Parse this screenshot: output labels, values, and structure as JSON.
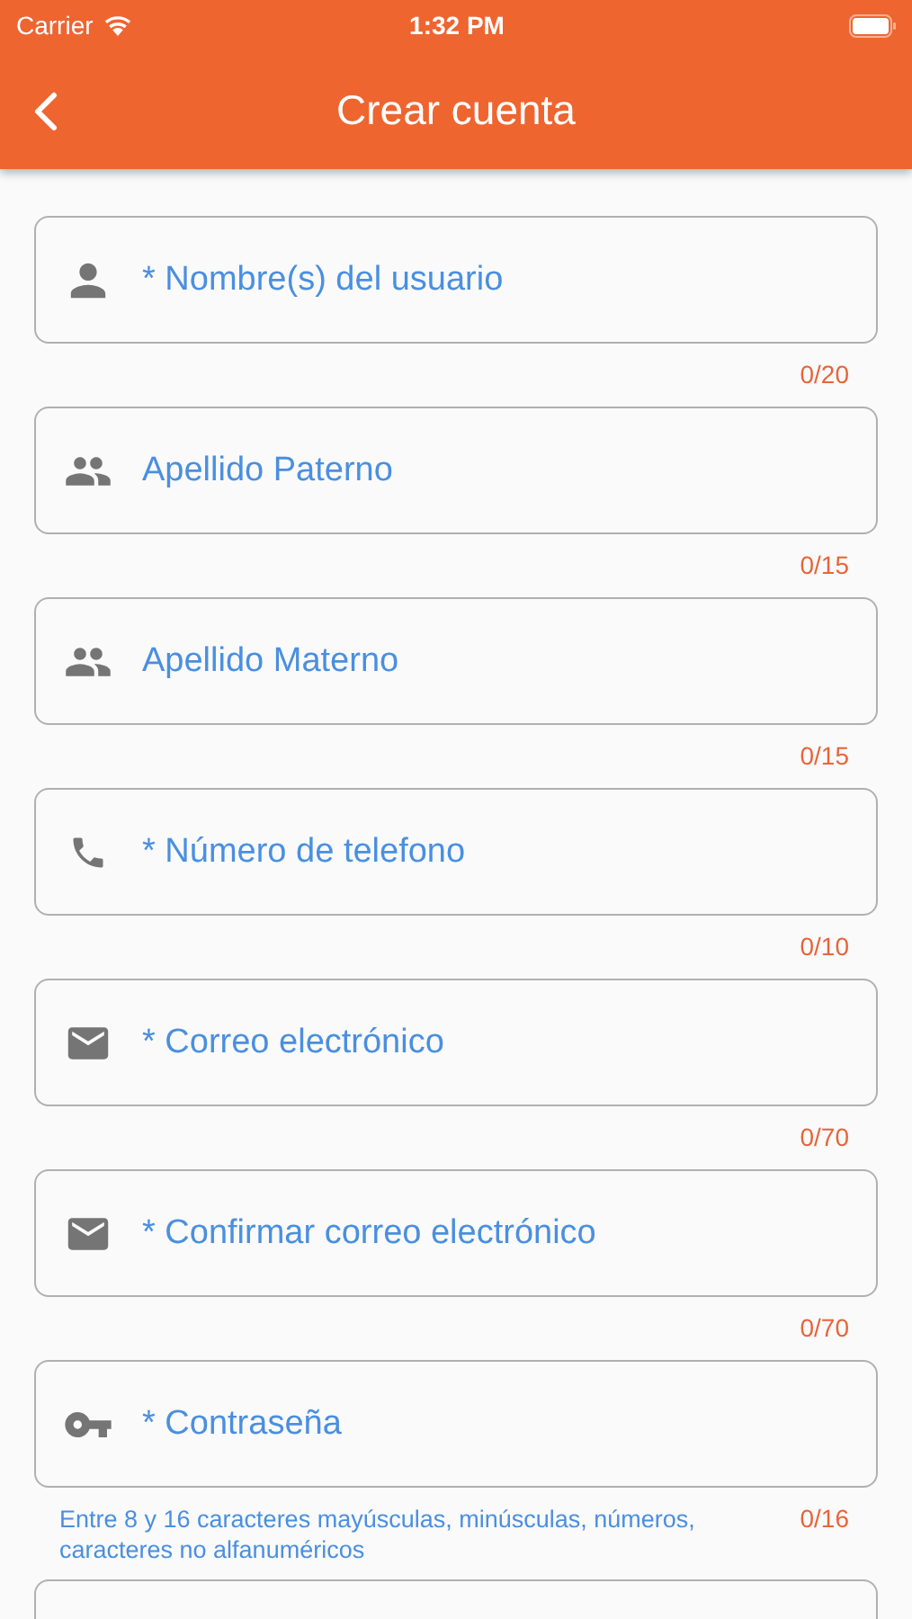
{
  "status_bar": {
    "carrier": "Carrier",
    "time": "1:32 PM"
  },
  "header": {
    "title": "Crear cuenta"
  },
  "fields": [
    {
      "kind": "person",
      "placeholder": "* Nombre(s) del usuario",
      "counter": "0/20"
    },
    {
      "kind": "group",
      "placeholder": "Apellido Paterno",
      "counter": "0/15"
    },
    {
      "kind": "group",
      "placeholder": "Apellido Materno",
      "counter": "0/15"
    },
    {
      "kind": "phone",
      "placeholder": "* Número de telefono",
      "counter": "0/10"
    },
    {
      "kind": "email",
      "placeholder": "* Correo electrónico",
      "counter": "0/70"
    },
    {
      "kind": "email",
      "placeholder": "* Confirmar correo electrónico",
      "counter": "0/70"
    },
    {
      "kind": "password",
      "placeholder": "* Contraseña",
      "counter": "0/16",
      "helper": "Entre 8 y 16 caracteres mayúsculas, minúsculas, números, caracteres no alfanuméricos"
    }
  ]
}
